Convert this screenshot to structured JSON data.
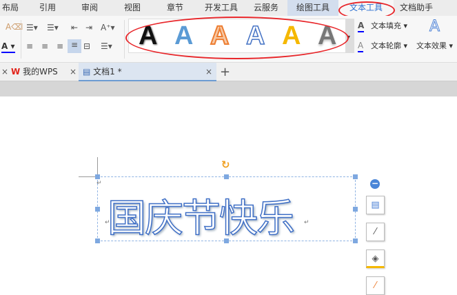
{
  "menu": {
    "tabs": [
      "布局",
      "引用",
      "审阅",
      "视图",
      "章节",
      "开发工具",
      "云服务",
      "绘图工具",
      "文本工具",
      "文档助手"
    ],
    "active": "文本工具"
  },
  "ribbon": {
    "text_fill": "文本填充",
    "text_outline": "文本轮廓",
    "text_effect": "文本效果",
    "styles": [
      "A",
      "A",
      "A",
      "A",
      "A",
      "A"
    ]
  },
  "tabs": {
    "home": "我的WPS",
    "doc": "文档1 *",
    "new": "+",
    "close": "×"
  },
  "document": {
    "wordart_text": "国庆节快乐",
    "paragraph_mark": "↵"
  },
  "colors": {
    "accent": "#2a6fd0",
    "annotation": "#e8262a"
  }
}
